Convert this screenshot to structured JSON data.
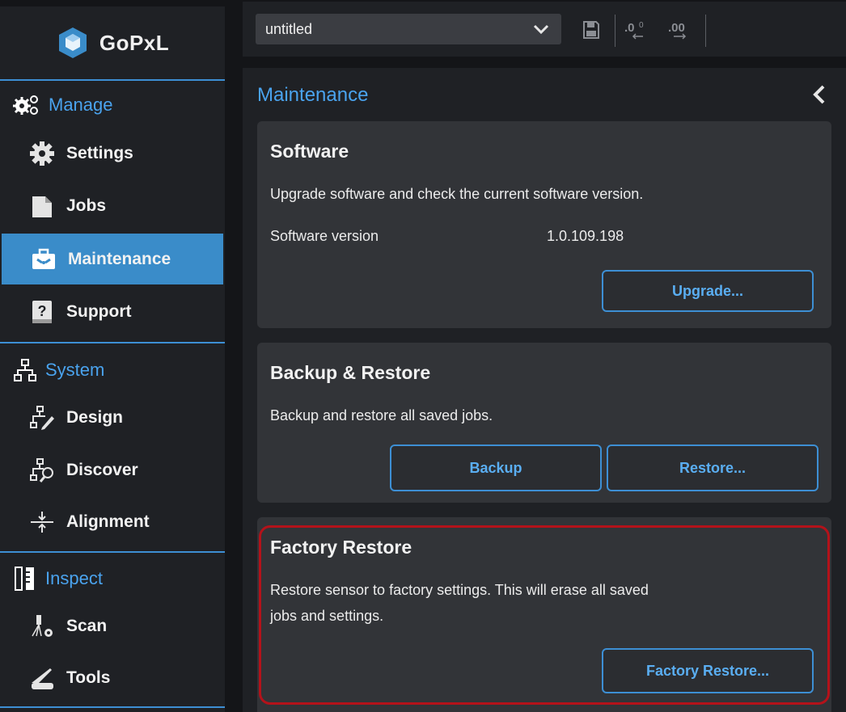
{
  "app": {
    "name": "GoPxL"
  },
  "toolbar": {
    "job_name": "untitled"
  },
  "sidebar": {
    "sections": [
      {
        "label": "Manage",
        "items": [
          {
            "label": "Settings"
          },
          {
            "label": "Jobs"
          },
          {
            "label": "Maintenance",
            "active": true
          },
          {
            "label": "Support"
          }
        ]
      },
      {
        "label": "System",
        "items": [
          {
            "label": "Design"
          },
          {
            "label": "Discover"
          },
          {
            "label": "Alignment"
          }
        ]
      },
      {
        "label": "Inspect",
        "items": [
          {
            "label": "Scan"
          },
          {
            "label": "Tools"
          }
        ]
      }
    ]
  },
  "main": {
    "title": "Maintenance",
    "software": {
      "title": "Software",
      "description": "Upgrade software and check the current software version.",
      "version_label": "Software version",
      "version_value": "1.0.109.198",
      "upgrade_button": "Upgrade..."
    },
    "backup": {
      "title": "Backup & Restore",
      "description": "Backup and restore all saved jobs.",
      "backup_button": "Backup",
      "restore_button": "Restore..."
    },
    "factory": {
      "title": "Factory Restore",
      "description_line1": "Restore sensor to factory settings. This will erase all saved",
      "description_line2": "jobs and settings.",
      "button": "Factory Restore..."
    }
  },
  "colors": {
    "accent": "#3d8fd4",
    "active_nav": "#3a8cc9",
    "highlight": "#b4121a"
  }
}
